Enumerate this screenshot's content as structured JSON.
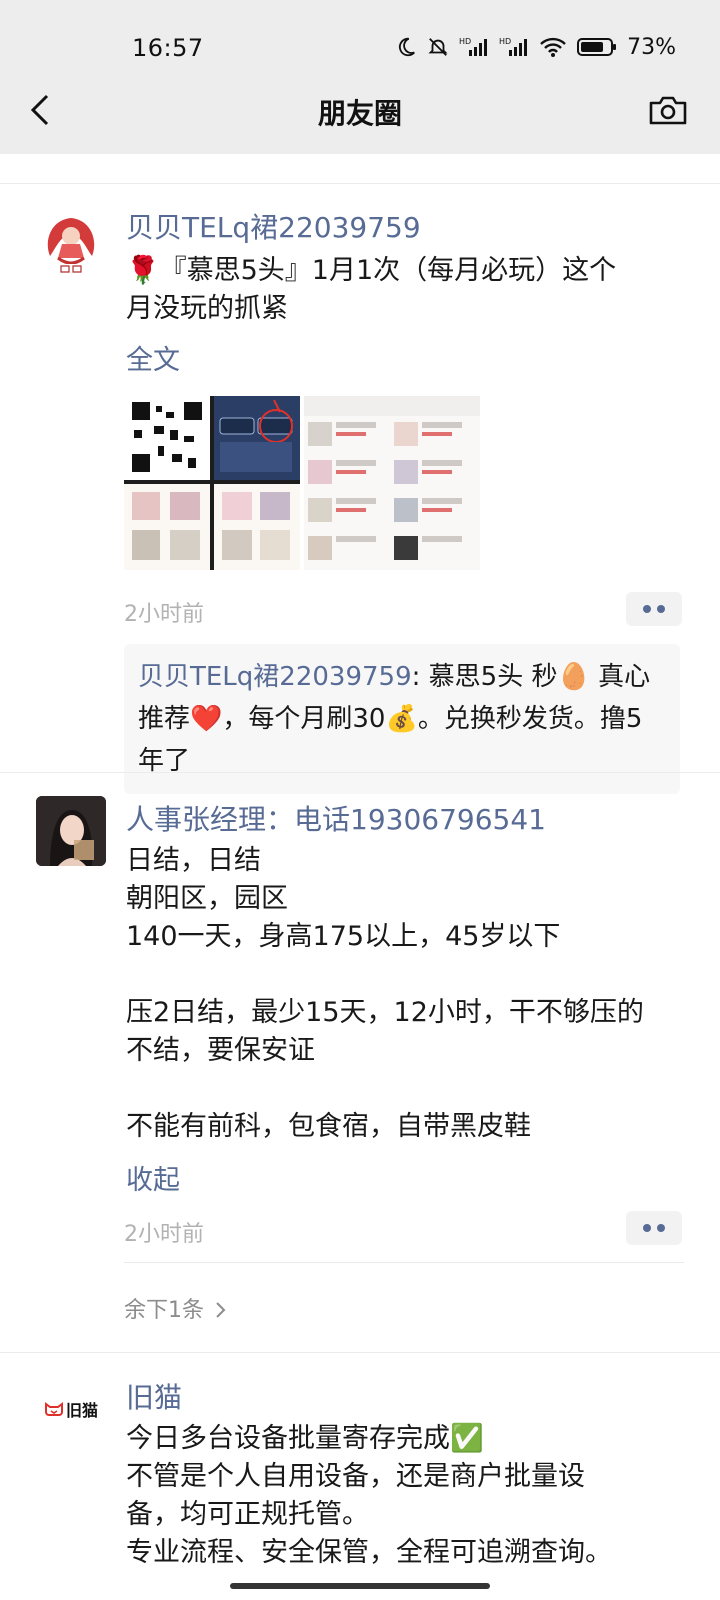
{
  "status_bar": {
    "time": "16:57",
    "battery": "73%",
    "icons": [
      "moon-icon",
      "mute-bell-icon",
      "signal-hd-icon",
      "signal-hd-icon",
      "wifi-icon",
      "battery-icon"
    ]
  },
  "nav": {
    "title": "朋友圈",
    "back_icon": "chevron-left-icon",
    "camera_icon": "camera-icon"
  },
  "colors": {
    "name_blue": "#576b95",
    "bar_bg": "#ededed",
    "time_gray": "#b2b2b2"
  },
  "posts": [
    {
      "name": "贝贝TELq裙22039759",
      "text_line1": "🌹『慕思5头』1月1次（每月必玩）这个",
      "text_line2": "月没玩的抓紧",
      "expand": "全文",
      "time": "2小时前",
      "comment": {
        "author": "贝贝TELq裙22039759",
        "text": ": 慕思5头 秒🥚 真心推荐❤️，每个月刷30💰。兑换秒发货。撸5年了"
      }
    },
    {
      "name": "人事张经理：电话19306796541",
      "lines": [
        "日结，日结",
        "朝阳区，园区",
        "140一天，身高175以上，45岁以下",
        "",
        "压2日结，最少15天，12小时，干不够压的",
        "不结，要保安证",
        "",
        "不能有前科，包食宿，自带黑皮鞋"
      ],
      "collapse": "收起",
      "time": "2小时前",
      "remaining": "余下1条"
    },
    {
      "name": "旧猫",
      "avatar_text": "旧猫",
      "lines": [
        "今日多台设备批量寄存完成✅",
        "不管是个人自用设备，还是商户批量设",
        "备，均可正规托管。",
        "专业流程、安全保管，全程可追溯查询。"
      ]
    }
  ]
}
